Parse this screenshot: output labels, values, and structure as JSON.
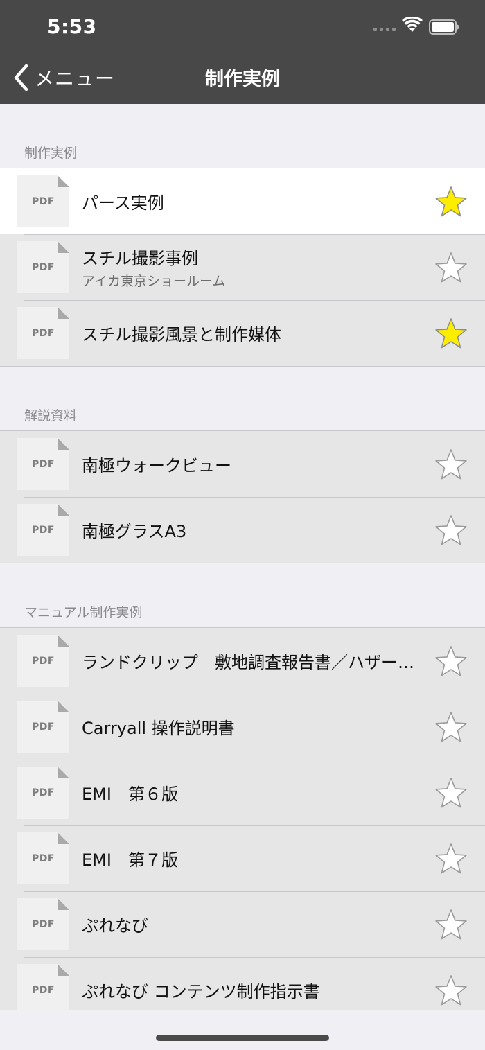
{
  "status_bar": {
    "time": "5:53"
  },
  "nav": {
    "back_label": "メニュー",
    "title": "制作実例"
  },
  "colors": {
    "star_on": "#ffed00",
    "star_off": "#ffffff",
    "nav_bg": "#484848"
  },
  "sections": [
    {
      "header": "制作実例",
      "rows": [
        {
          "thumb": "PDF",
          "title": "パース実例",
          "subtitle": "",
          "favorite": true,
          "selected": true
        },
        {
          "thumb": "PDF",
          "title": "スチル撮影事例",
          "subtitle": "アイカ東京ショールーム",
          "favorite": false,
          "selected": false
        },
        {
          "thumb": "PDF",
          "title": "スチル撮影風景と制作媒体",
          "subtitle": "",
          "favorite": true,
          "selected": false
        }
      ]
    },
    {
      "header": "解説資料",
      "rows": [
        {
          "thumb": "PDF",
          "title": "南極ウォークビュー",
          "subtitle": "",
          "favorite": false,
          "selected": false
        },
        {
          "thumb": "PDF",
          "title": "南極グラスA3",
          "subtitle": "",
          "favorite": false,
          "selected": false
        }
      ]
    },
    {
      "header": "マニュアル制作実例",
      "rows": [
        {
          "thumb": "PDF",
          "title": "ランドクリップ　敷地調査報告書／ハザード…",
          "subtitle": "",
          "favorite": false,
          "selected": false
        },
        {
          "thumb": "PDF",
          "title": "Carryall 操作説明書",
          "subtitle": "",
          "favorite": false,
          "selected": false
        },
        {
          "thumb": "PDF",
          "title": "EMI　第６版",
          "subtitle": "",
          "favorite": false,
          "selected": false
        },
        {
          "thumb": "PDF",
          "title": "EMI　第７版",
          "subtitle": "",
          "favorite": false,
          "selected": false
        },
        {
          "thumb": "PDF",
          "title": "ぷれなび",
          "subtitle": "",
          "favorite": false,
          "selected": false
        },
        {
          "thumb": "PDF",
          "title": "ぷれなび コンテンツ制作指示書",
          "subtitle": "",
          "favorite": false,
          "selected": false
        }
      ]
    }
  ]
}
